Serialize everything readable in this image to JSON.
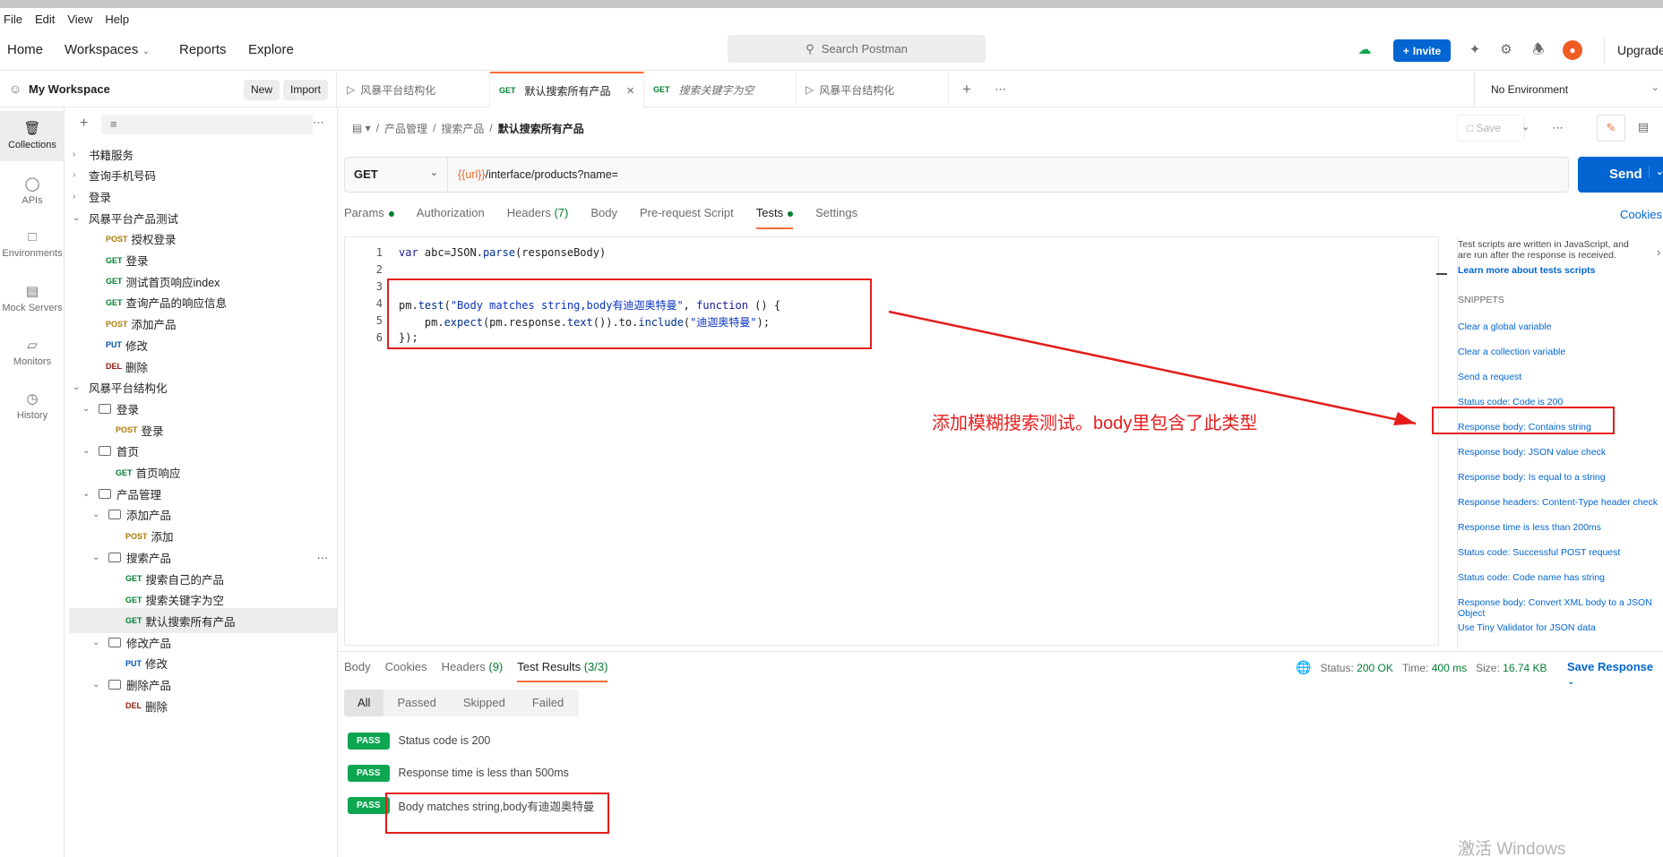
{
  "app_title": "Postman",
  "menu": [
    "File",
    "Edit",
    "View",
    "Help"
  ],
  "nav": {
    "home": "Home",
    "workspaces": "Workspaces",
    "reports": "Reports",
    "explore": "Explore"
  },
  "search_placeholder": "Search Postman",
  "invite_label": "Invite",
  "upgrade_label": "Upgrade",
  "workspace": {
    "name": "My Workspace",
    "new_label": "New",
    "import_label": "Import"
  },
  "rail": [
    {
      "label": "Collections",
      "icon": "collections-icon"
    },
    {
      "label": "APIs",
      "icon": "apis-icon"
    },
    {
      "label": "Environments",
      "icon": "environments-icon"
    },
    {
      "label": "Mock Servers",
      "icon": "mock-servers-icon"
    },
    {
      "label": "Monitors",
      "icon": "monitors-icon"
    },
    {
      "label": "History",
      "icon": "history-icon"
    }
  ],
  "tree": [
    {
      "level": 0,
      "kind": "collection",
      "label": "书籍服务",
      "open": false
    },
    {
      "level": 0,
      "kind": "collection",
      "label": "查询手机号码",
      "open": false
    },
    {
      "level": 0,
      "kind": "collection",
      "label": "登录",
      "open": false
    },
    {
      "level": 0,
      "kind": "collection",
      "label": "风暴平台产品测试",
      "open": true
    },
    {
      "level": 1,
      "kind": "request",
      "method": "POST",
      "label": "授权登录"
    },
    {
      "level": 1,
      "kind": "request",
      "method": "GET",
      "label": "登录"
    },
    {
      "level": 1,
      "kind": "request",
      "method": "GET",
      "label": "测试首页响应index"
    },
    {
      "level": 1,
      "kind": "request",
      "method": "GET",
      "label": "查询产品的响应信息"
    },
    {
      "level": 1,
      "kind": "request",
      "method": "POST",
      "label": "添加产品"
    },
    {
      "level": 1,
      "kind": "request",
      "method": "PUT",
      "label": "修改"
    },
    {
      "level": 1,
      "kind": "request",
      "method": "DEL",
      "label": "删除"
    },
    {
      "level": 0,
      "kind": "collection",
      "label": "风暴平台结构化",
      "open": true
    },
    {
      "level": 1,
      "kind": "folder",
      "label": "登录",
      "open": true
    },
    {
      "level": 2,
      "kind": "request",
      "method": "POST",
      "label": "登录"
    },
    {
      "level": 1,
      "kind": "folder",
      "label": "首页",
      "open": true
    },
    {
      "level": 2,
      "kind": "request",
      "method": "GET",
      "label": "首页响应"
    },
    {
      "level": 1,
      "kind": "folder",
      "label": "产品管理",
      "open": true
    },
    {
      "level": 2,
      "kind": "folder",
      "label": "添加产品",
      "open": true
    },
    {
      "level": 3,
      "kind": "request",
      "method": "POST",
      "label": "添加"
    },
    {
      "level": 2,
      "kind": "folder",
      "label": "搜索产品",
      "open": true,
      "more": true
    },
    {
      "level": 3,
      "kind": "request",
      "method": "GET",
      "label": "搜索自己的产品"
    },
    {
      "level": 3,
      "kind": "request",
      "method": "GET",
      "label": "搜索关键字为空"
    },
    {
      "level": 3,
      "kind": "request",
      "method": "GET",
      "label": "默认搜索所有产品",
      "selected": true
    },
    {
      "level": 2,
      "kind": "folder",
      "label": "修改产品",
      "open": true
    },
    {
      "level": 3,
      "kind": "request",
      "method": "PUT",
      "label": "修改"
    },
    {
      "level": 2,
      "kind": "folder",
      "label": "删除产品",
      "open": true
    },
    {
      "level": 3,
      "kind": "request",
      "method": "DEL",
      "label": "删除"
    }
  ],
  "tabs": [
    {
      "icon": "runner-icon",
      "method": "",
      "label": "风暴平台结构化"
    },
    {
      "icon": "",
      "method": "GET",
      "label": "默认搜索所有产品",
      "active": true
    },
    {
      "icon": "",
      "method": "GET",
      "label": "搜索关键字为空",
      "italic": true
    },
    {
      "icon": "runner-icon",
      "method": "",
      "label": "风暴平台结构化"
    }
  ],
  "environment": "No Environment",
  "breadcrumb": [
    "产品管理",
    "搜索产品",
    "默认搜索所有产品"
  ],
  "save_label": "Save",
  "request": {
    "method": "GET",
    "url_var": "{{url}}",
    "url_rest": "/interface/products?name=",
    "send_label": "Send"
  },
  "request_tabs": [
    {
      "label": "Params",
      "dot": true
    },
    {
      "label": "Authorization"
    },
    {
      "label": "Headers",
      "count": "(7)"
    },
    {
      "label": "Body"
    },
    {
      "label": "Pre-request Script"
    },
    {
      "label": "Tests",
      "dot": true,
      "active": true
    },
    {
      "label": "Settings"
    }
  ],
  "cookies_label": "Cookies",
  "code_lines": [
    {
      "n": "1",
      "html": "<span class=\"kw\">var</span> abc=JSON.<span class=\"fn\">parse</span>(responseBody)"
    },
    {
      "n": "2",
      "html": ""
    },
    {
      "n": "3",
      "html": ""
    },
    {
      "n": "4",
      "html": "pm.<span class=\"fn\">test</span>(<span class=\"str\">\"Body matches string,body有迪迦奥特曼\"</span>, <span class=\"kw\">function</span> () {"
    },
    {
      "n": "5",
      "html": "    pm.<span class=\"fn\">expect</span>(pm.response.<span class=\"fn\">text</span>()).to.<span class=\"fn\">include</span>(<span class=\"str\">\"迪迦奥特曼\"</span>);"
    },
    {
      "n": "6",
      "html": "});"
    }
  ],
  "snippets": {
    "intro": "Test scripts are written in JavaScript, and are run after the response is received.",
    "learn": "Learn more about tests scripts",
    "title": "SNIPPETS",
    "items": [
      "Clear a global variable",
      "Clear a collection variable",
      "Send a request",
      "Status code: Code is 200",
      "Response body: Contains string",
      "Response body: JSON value check",
      "Response body: Is equal to a string",
      "Response headers: Content-Type header check",
      "Response time is less than 200ms",
      "Status code: Successful POST request",
      "Status code: Code name has string",
      "Response body: Convert XML body to a JSON Object",
      "Use Tiny Validator for JSON data"
    ]
  },
  "annotation": "添加模糊搜索测试。body里包含了此类型",
  "response_tabs": [
    {
      "label": "Body"
    },
    {
      "label": "Cookies"
    },
    {
      "label": "Headers",
      "count": "(9)"
    },
    {
      "label": "Test Results",
      "count": "(3/3)",
      "active": true
    }
  ],
  "status": {
    "status_label": "Status:",
    "status_val": "200 OK",
    "time_label": "Time:",
    "time_val": "400 ms",
    "size_label": "Size:",
    "size_val": "16.74 KB",
    "save_response": "Save Response"
  },
  "filters": [
    "All",
    "Passed",
    "Skipped",
    "Failed"
  ],
  "results": [
    {
      "badge": "PASS",
      "label": "Status code is 200"
    },
    {
      "badge": "PASS",
      "label": "Response time is less than 500ms"
    },
    {
      "badge": "PASS",
      "label": "Body matches string,body有迪迦奥特曼"
    }
  ],
  "watermark": "激活 Windows",
  "colors": {
    "accent": "#ff6c37",
    "primary": "#0265d2",
    "pass": "#0da651",
    "annotation": "#e61c1c"
  }
}
